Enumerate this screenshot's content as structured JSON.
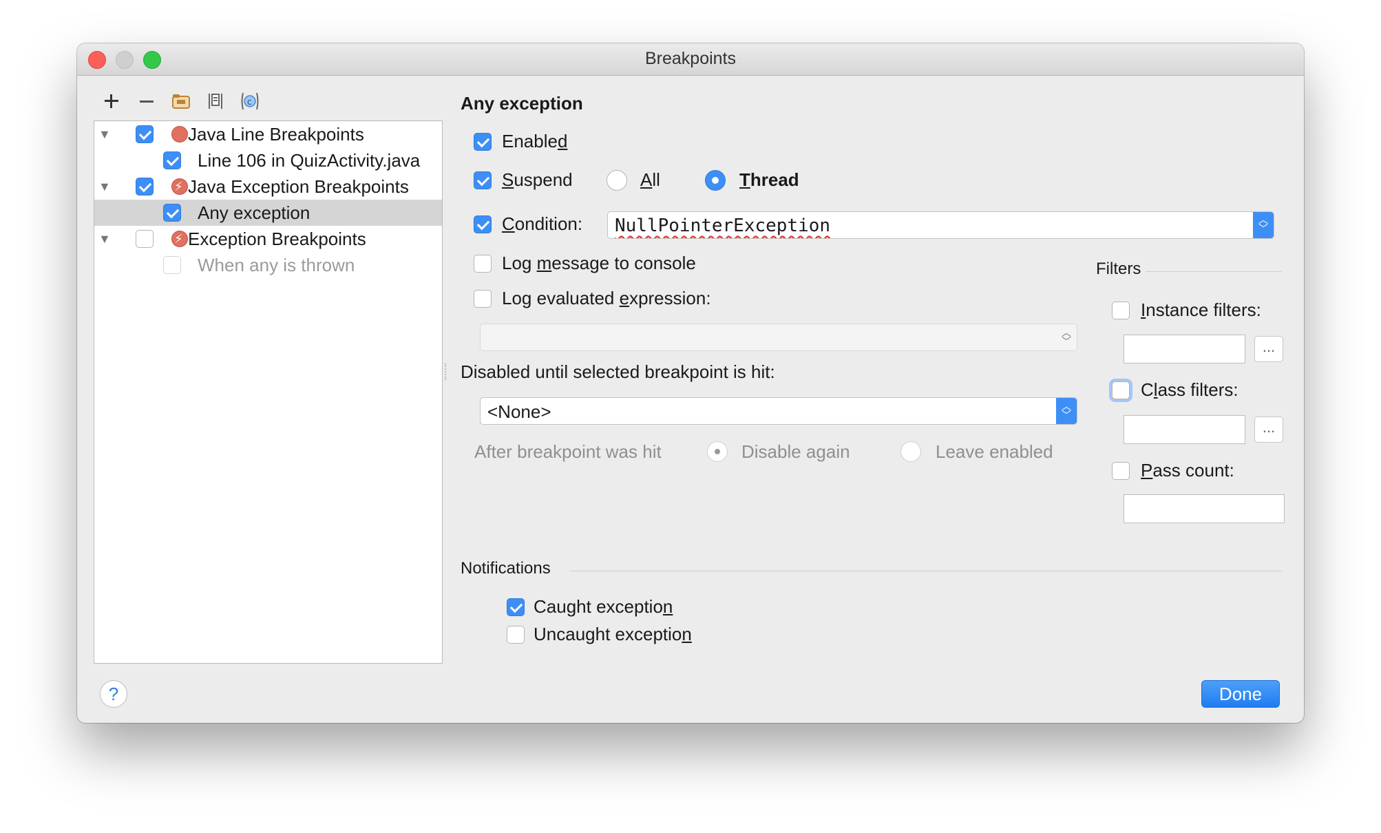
{
  "window": {
    "title": "Breakpoints"
  },
  "toolbar": {
    "add_icon": "plus-icon",
    "remove_icon": "minus-icon",
    "group_icon": "folder-icon",
    "export_icon": "document-icon",
    "class_icon": "class-c-icon"
  },
  "tree": {
    "items": [
      {
        "label": "Java Line Breakpoints",
        "checked": true,
        "expanded": true,
        "icon": "red-breakpoint-icon"
      },
      {
        "label": "Line 106 in QuizActivity.java",
        "checked": true
      },
      {
        "label": "Java Exception Breakpoints",
        "checked": true,
        "expanded": true,
        "icon": "exception-breakpoint-icon"
      },
      {
        "label": "Any exception",
        "checked": true,
        "selected": true
      },
      {
        "label": "Exception Breakpoints",
        "checked": false,
        "expanded": true,
        "icon": "exception-breakpoint-icon"
      },
      {
        "label": "When any is thrown",
        "checked": false,
        "disabled": true
      }
    ]
  },
  "details": {
    "title": "Any exception",
    "enabled": {
      "pre": "Enable",
      "u": "d",
      "post": "",
      "checked": true
    },
    "suspend": {
      "pre": "",
      "u": "S",
      "post": "uspend",
      "checked": true
    },
    "suspend_all": {
      "pre": "",
      "u": "A",
      "post": "ll",
      "selected": false
    },
    "suspend_thread": {
      "pre": "",
      "u": "T",
      "post": "hread",
      "selected": true
    },
    "condition": {
      "pre": "",
      "u": "C",
      "post": "ondition:",
      "checked": true,
      "value": "NullPointerException"
    },
    "log_message": {
      "pre": "Log ",
      "u": "m",
      "post": "essage to console",
      "checked": false
    },
    "log_expression": {
      "pre": "Log evaluated ",
      "u": "e",
      "post": "xpression:",
      "checked": false,
      "value": ""
    },
    "disabled_until_label": "Disabled until selected breakpoint is hit:",
    "disabled_until_value": "<None>",
    "after_hit_label": "After breakpoint was hit",
    "disable_again": "Disable again",
    "leave_enabled": "Leave enabled"
  },
  "filters": {
    "title": "Filters",
    "instance": {
      "pre": "",
      "u": "I",
      "post": "nstance filters:",
      "checked": false,
      "value": ""
    },
    "class": {
      "pre": "C",
      "u": "l",
      "post": "ass filters:",
      "checked": false,
      "value": ""
    },
    "pass_count": {
      "pre": "",
      "u": "P",
      "post": "ass count:",
      "checked": false,
      "value": ""
    },
    "browse_label": "..."
  },
  "notifications": {
    "title": "Notifications",
    "caught": {
      "pre": "Caught exceptio",
      "u": "n",
      "post": "",
      "checked": true
    },
    "uncaught": {
      "pre": "Uncaught exceptio",
      "u": "n",
      "post": "",
      "checked": false
    }
  },
  "footer": {
    "help_label": "?",
    "done_label": "Done"
  },
  "colors": {
    "accent": "#3d8ff6",
    "window_bg": "#ececec",
    "selection": "#d5d5d5"
  }
}
